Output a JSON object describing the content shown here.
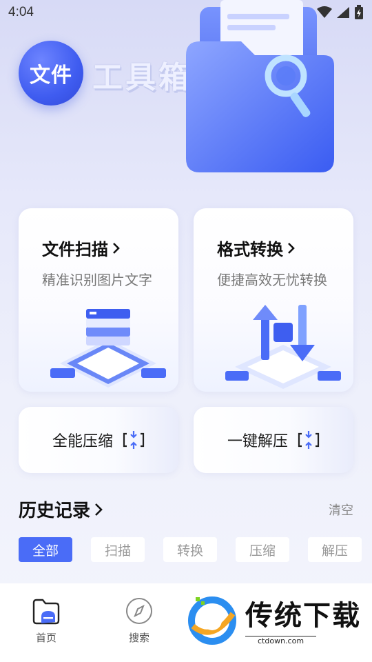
{
  "status_bar": {
    "time": "4:04"
  },
  "hero": {
    "logo_badge": "文件",
    "logo_title": "工具箱"
  },
  "cards": {
    "scan": {
      "title": "文件扫描",
      "subtitle": "精准识别图片文字"
    },
    "convert": {
      "title": "格式转换",
      "subtitle": "便捷高效无忧转换"
    },
    "compress": {
      "label": "全能压缩"
    },
    "decompress": {
      "label": "一键解压"
    }
  },
  "history": {
    "title": "历史记录",
    "clear": "清空",
    "tabs": [
      "全部",
      "扫描",
      "转换",
      "压缩",
      "解压"
    ],
    "active_tab": "全部"
  },
  "bottom_nav": {
    "home": "首页",
    "search": "搜索"
  },
  "watermark": {
    "name": "传统下载",
    "url": "ctdown.com"
  },
  "colors": {
    "accent": "#4a6cf7",
    "logo": "#3f5cf0"
  }
}
